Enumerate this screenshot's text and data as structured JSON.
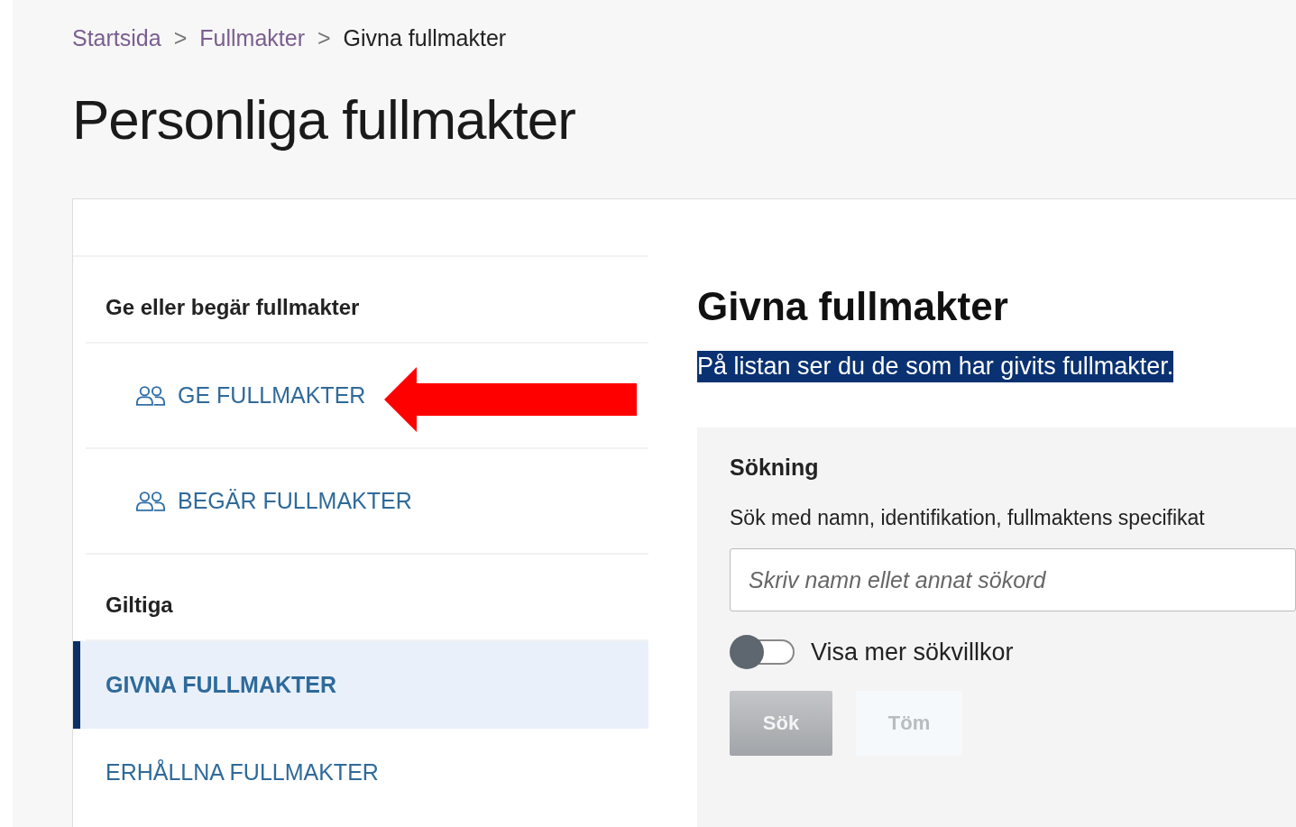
{
  "breadcrumb": [
    {
      "label": "Startsida",
      "current": false
    },
    {
      "label": ">",
      "kind": "separator"
    },
    {
      "label": "Fullmakter",
      "current": false
    },
    {
      "label": ">",
      "kind": "separator"
    },
    {
      "label": "Givna fullmakter",
      "current": true
    }
  ],
  "page_title": "Personliga fullmakter",
  "sidebar": {
    "sections": [
      {
        "heading": "Ge eller begär fullmakter",
        "items": [
          {
            "label": "GE FULLMAKTER",
            "kind": "icon-link"
          },
          {
            "label": "BEGÄR FULLMAKTER",
            "kind": "icon-link"
          }
        ]
      },
      {
        "heading": "Giltiga",
        "items": [
          {
            "label": "GIVNA FULLMAKTER",
            "kind": "nav",
            "selected": true
          },
          {
            "label": "ERHÅLLNA FULLMAKTER",
            "kind": "nav",
            "selected": false
          }
        ]
      }
    ]
  },
  "main": {
    "title": "Givna fullmakter",
    "intro": {
      "text": "På listan ser du de som har givits fullmakter.",
      "highlighted": true
    },
    "search": {
      "heading": "Sökning",
      "description": "Sök med namn, identifikation, fullmaktens specifikat",
      "placeholder": "Skriv namn ellet annat sökord",
      "toggle": {
        "label": "Visa mer sökvillkor",
        "on": false
      },
      "buttons": [
        {
          "label": "Sök",
          "kind": "primary",
          "disabled": true
        },
        {
          "label": "Töm",
          "kind": "secondary",
          "disabled": true
        }
      ]
    }
  }
}
